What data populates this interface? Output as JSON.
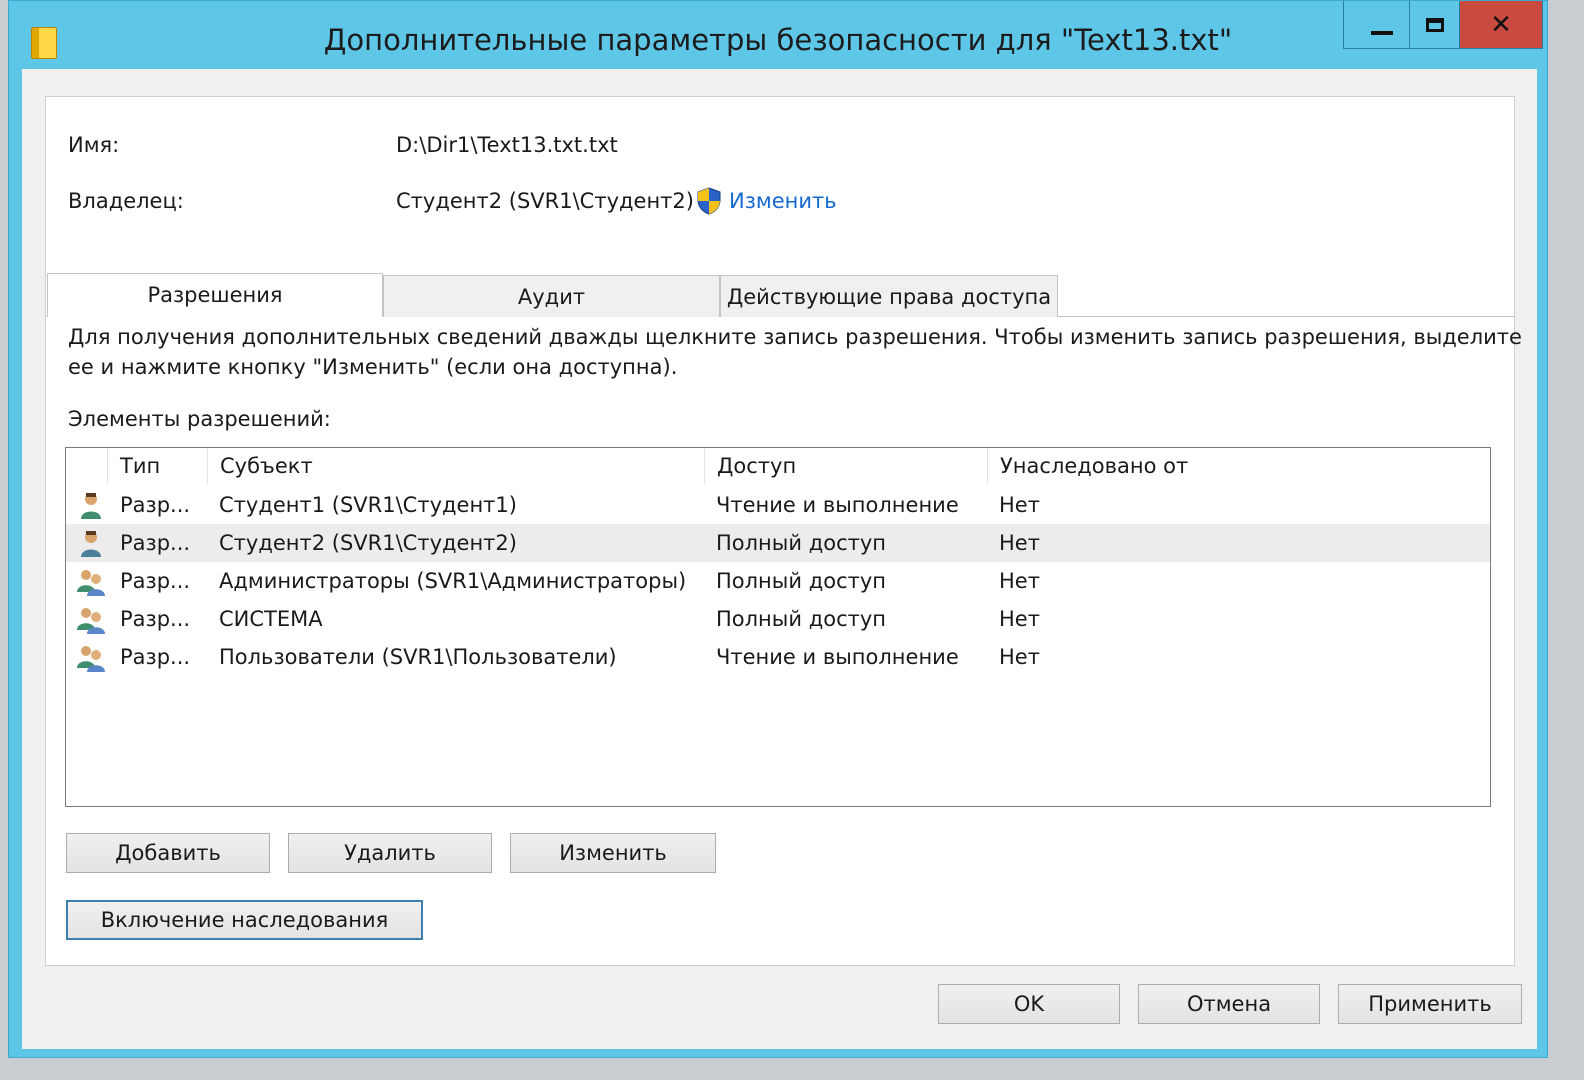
{
  "window": {
    "title": "Дополнительные параметры безопасности  для \"Text13.txt\"",
    "controls": {
      "close_glyph": "✕"
    }
  },
  "info": {
    "name_label": "Имя:",
    "name_value": "D:\\Dir1\\Text13.txt.txt",
    "owner_label": "Владелец:",
    "owner_value": "Студент2 (SVR1\\Студент2)",
    "change_link": "Изменить"
  },
  "tabs": [
    {
      "label": "Разрешения",
      "active": true
    },
    {
      "label": "Аудит",
      "active": false
    },
    {
      "label": "Действующие права доступа",
      "active": false
    }
  ],
  "description": {
    "line1": "Для получения дополнительных сведений дважды щелкните запись разрешения. Чтобы изменить запись разрешения, выделите",
    "line2": "ее и нажмите кнопку \"Изменить\" (если она доступна).",
    "list_label": "Элементы разрешений:"
  },
  "table": {
    "columns": [
      "Тип",
      "Субъект",
      "Доступ",
      "Унаследовано от"
    ],
    "rows": [
      {
        "icon": "user-icon",
        "type": "Разр...",
        "subject": "Студент1 (SVR1\\Студент1)",
        "access": "Чтение и выполнение",
        "inherited": "Нет"
      },
      {
        "icon": "user-icon",
        "type": "Разр...",
        "subject": "Студент2 (SVR1\\Студент2)",
        "access": "Полный доступ",
        "inherited": "Нет"
      },
      {
        "icon": "group-icon",
        "type": "Разр...",
        "subject": "Администраторы (SVR1\\Администраторы)",
        "access": "Полный доступ",
        "inherited": "Нет"
      },
      {
        "icon": "group-icon",
        "type": "Разр...",
        "subject": "СИСТЕМА",
        "access": "Полный доступ",
        "inherited": "Нет"
      },
      {
        "icon": "group-icon",
        "type": "Разр...",
        "subject": "Пользователи (SVR1\\Пользователи)",
        "access": "Чтение и выполнение",
        "inherited": "Нет"
      }
    ]
  },
  "buttons": {
    "add": "Добавить",
    "remove": "Удалить",
    "edit": "Изменить",
    "inheritance": "Включение наследования",
    "ok": "OK",
    "cancel": "Отмена",
    "apply": "Применить"
  }
}
